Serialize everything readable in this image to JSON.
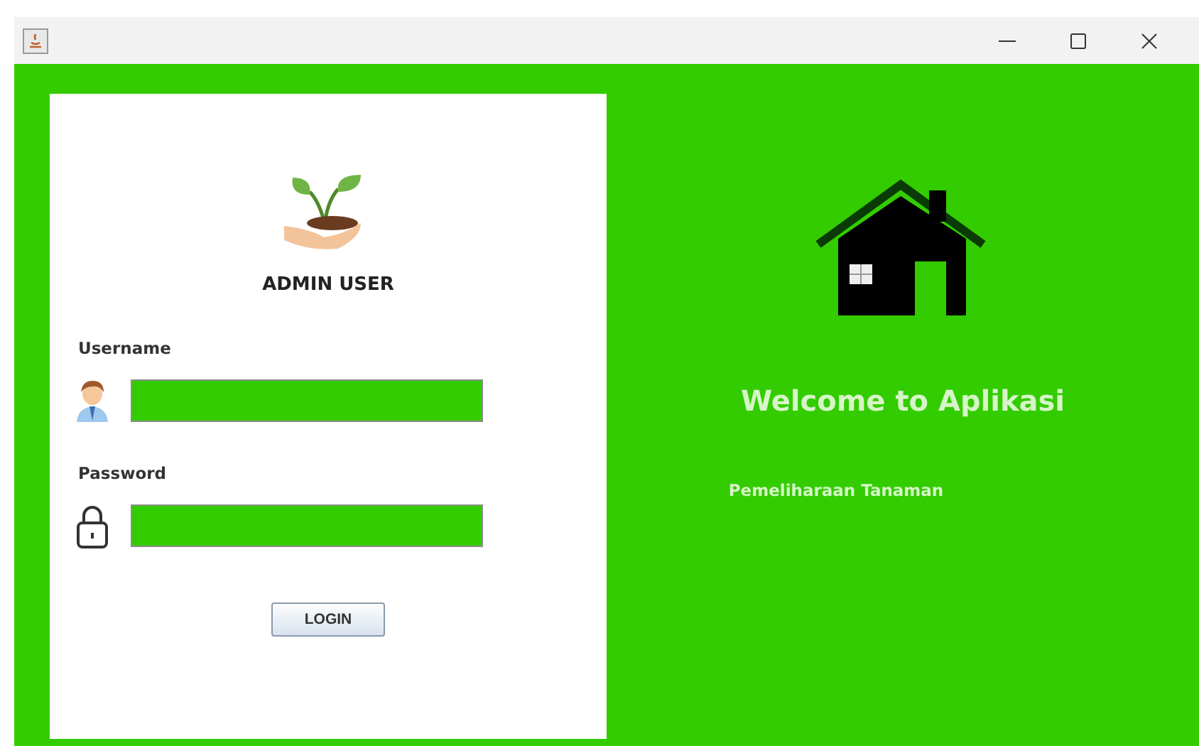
{
  "login_panel": {
    "heading": "ADMIN USER",
    "fields": [
      {
        "kind": "user",
        "label": "Username"
      },
      {
        "kind": "password",
        "label": "Password"
      }
    ],
    "button": "LOGIN"
  },
  "welcome_panel": {
    "title": "Welcome to Aplikasi",
    "subtitle": "Pemeliharaan Tanaman"
  }
}
